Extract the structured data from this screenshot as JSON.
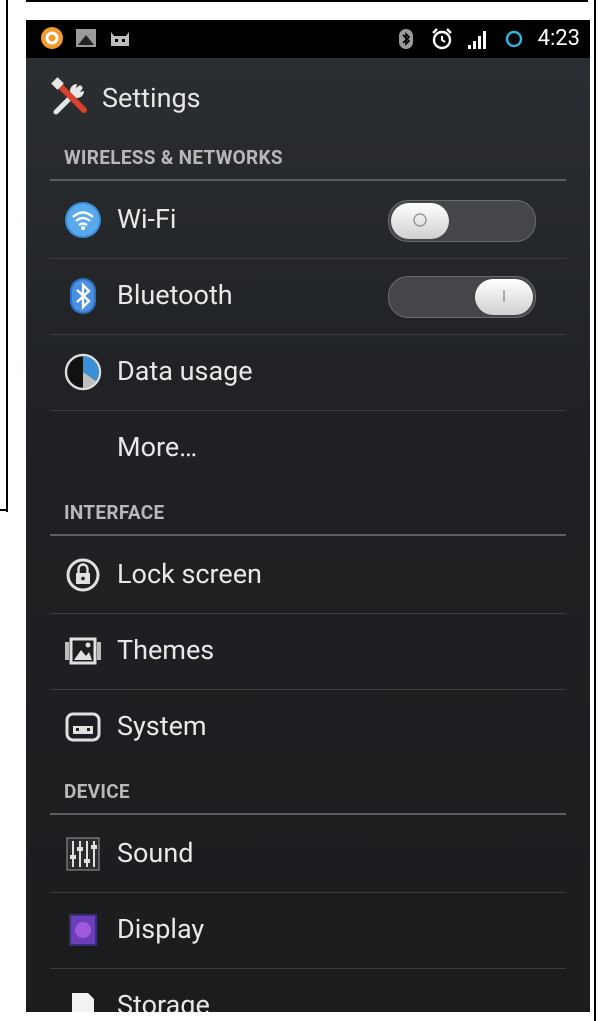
{
  "status_bar": {
    "time": "4:23"
  },
  "action_bar": {
    "title": "Settings"
  },
  "sections": {
    "wireless": "WIRELESS & NETWORKS",
    "interface": "INTERFACE",
    "device": "DEVICE"
  },
  "items": {
    "wifi": "Wi-Fi",
    "bluetooth": "Bluetooth",
    "data_usage": "Data usage",
    "more": "More…",
    "lock_screen": "Lock screen",
    "themes": "Themes",
    "system": "System",
    "sound": "Sound",
    "display": "Display",
    "storage": "Storage"
  },
  "toggles": {
    "wifi": "off",
    "bluetooth": "on"
  },
  "colors": {
    "accent_blue": "#33b5e5",
    "background": "#1f2124"
  }
}
